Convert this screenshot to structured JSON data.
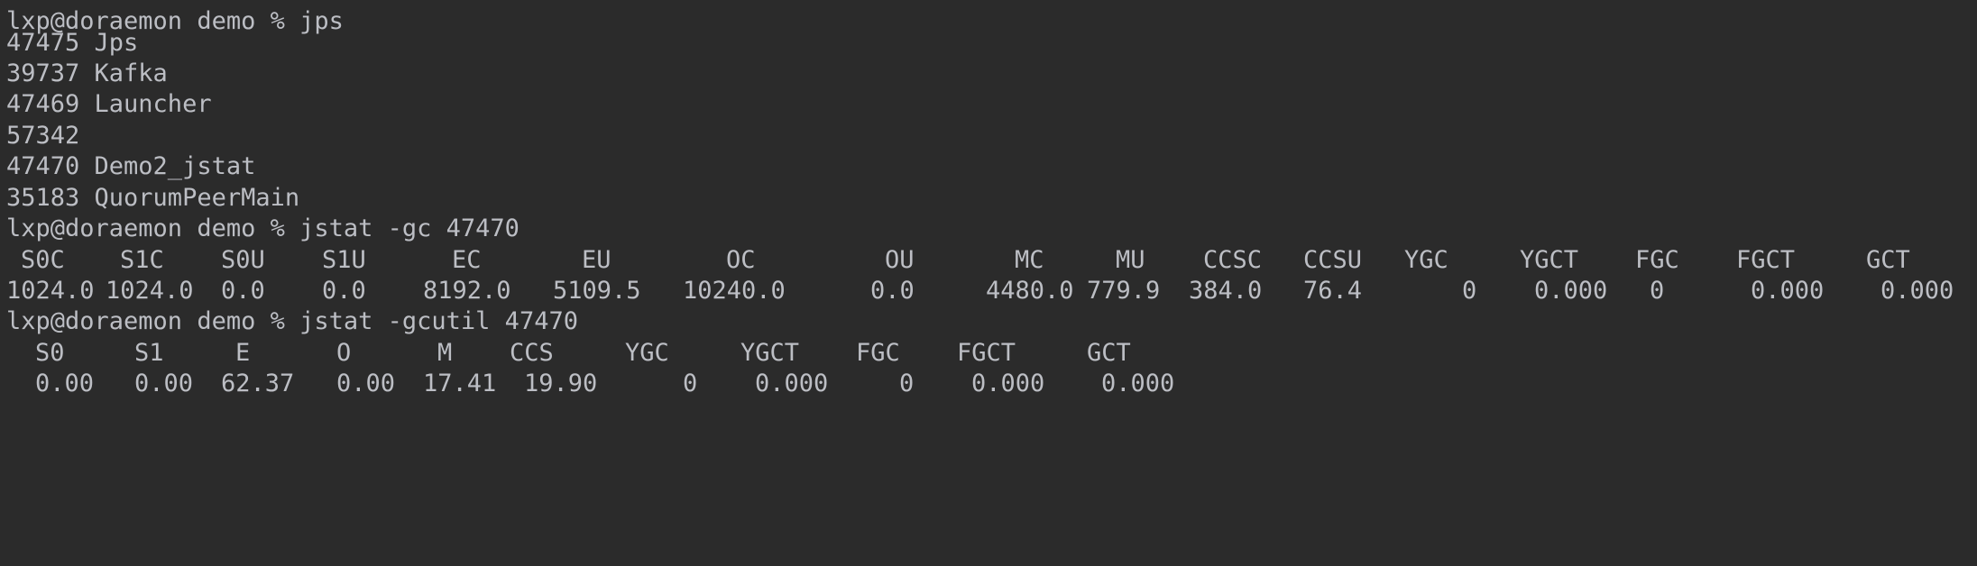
{
  "terminal": {
    "prompt": "lxp@doraemon demo % ",
    "commands": {
      "jps": "jps",
      "gc": "jstat -gc 47470",
      "gcutil": "jstat -gcutil 47470"
    },
    "jps_output": [
      "47475 Jps",
      "39737 Kafka",
      "47469 Launcher",
      "57342",
      "47470 Demo2_jstat",
      "35183 QuorumPeerMain"
    ],
    "gc_table": {
      "headers": [
        "S0C",
        "S1C",
        "S0U",
        "S1U",
        "EC",
        "EU",
        "OC",
        "OU",
        "MC",
        "MU",
        "CCSC",
        "CCSU",
        "YGC",
        "YGCT",
        "FGC",
        "FGCT",
        "GCT"
      ],
      "values": [
        "1024.0",
        "1024.0",
        "0.0",
        "0.0",
        "8192.0",
        "5109.5",
        "10240.0",
        "0.0",
        "4480.0",
        "779.9",
        "384.0",
        "76.4",
        "0",
        "0.000",
        "0",
        "0.000",
        "0.000"
      ]
    },
    "gcutil_table": {
      "headers": [
        "S0",
        "S1",
        "E",
        "O",
        "M",
        "CCS",
        "YGC",
        "YGCT",
        "FGC",
        "FGCT",
        "GCT"
      ],
      "values": [
        "0.00",
        "0.00",
        "62.37",
        "0.00",
        "17.41",
        "19.90",
        "0",
        "0.000",
        "0",
        "0.000",
        "0.000"
      ]
    }
  }
}
